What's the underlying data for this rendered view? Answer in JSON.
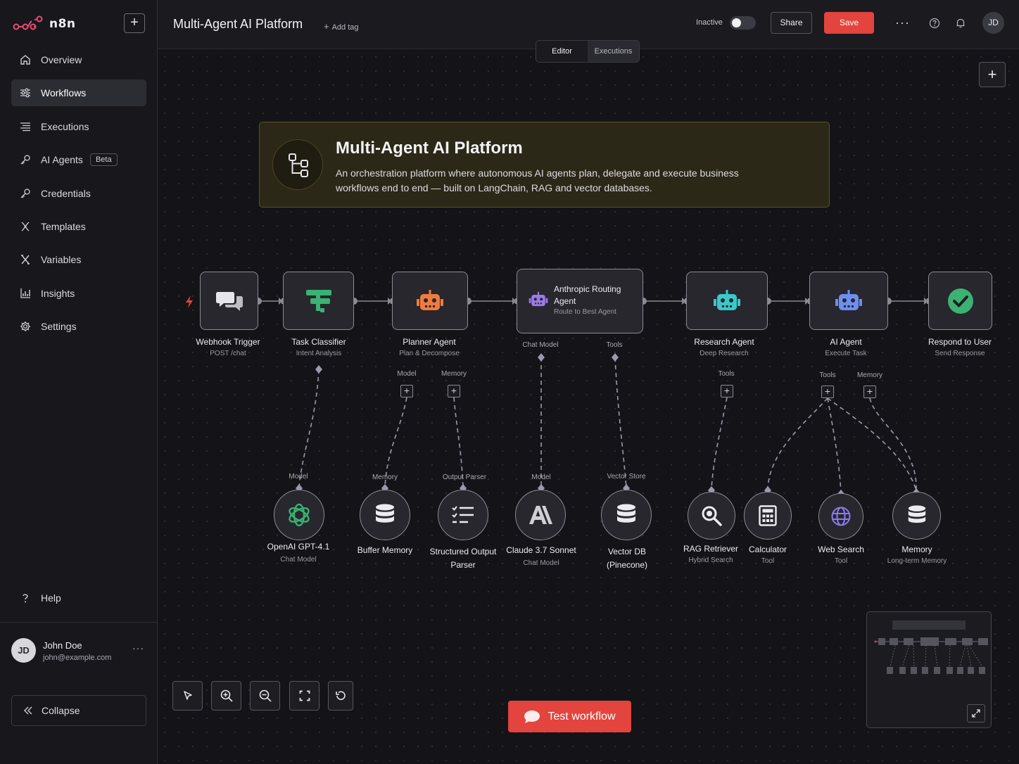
{
  "app": {
    "name": "n8n"
  },
  "sidebar": {
    "items": [
      {
        "label": "Overview",
        "icon": "home-icon"
      },
      {
        "label": "Workflows",
        "icon": "workflows-icon",
        "active": true
      },
      {
        "label": "Executions",
        "icon": "list-icon"
      },
      {
        "label": "AI Agents",
        "icon": "key-icon",
        "badge": "Beta"
      },
      {
        "label": "Credentials",
        "icon": "key-icon"
      },
      {
        "label": "Templates",
        "icon": "templates-icon"
      },
      {
        "label": "Variables",
        "icon": "variable-icon"
      },
      {
        "label": "Insights",
        "icon": "chart-icon"
      },
      {
        "label": "Settings",
        "icon": "gear-icon"
      }
    ],
    "help": "Help",
    "user": {
      "initials": "JD",
      "name": "John Doe",
      "email": "john@example.com"
    },
    "collapse": "Collapse"
  },
  "header": {
    "title": "Multi-Agent AI Platform",
    "add_tag": "Add tag",
    "status": "Inactive",
    "share": "Share",
    "save": "Save",
    "avatar": "JD"
  },
  "tabs": [
    "Editor",
    "Executions"
  ],
  "sticky": {
    "title": "Multi-Agent AI Platform",
    "description": "An orchestration platform where autonomous AI agents plan, delegate and execute business workflows end to end — built on LangChain, RAG and vector databases."
  },
  "nodes": {
    "webhook": {
      "label": "Webhook Trigger",
      "sub": "POST /chat"
    },
    "classifier": {
      "label": "Task Classifier",
      "sub": "Intent Analysis"
    },
    "planner": {
      "label": "Planner Agent",
      "sub": "Plan & Decompose",
      "port_model": "Model",
      "port_memory": "Memory"
    },
    "router": {
      "label": "Anthropic Routing Agent",
      "sub": "Route to Best Agent",
      "port_model": "Chat Model",
      "port_tools": "Tools"
    },
    "research": {
      "label": "Research Agent",
      "sub": "Deep Research",
      "port_tools": "Tools"
    },
    "agent": {
      "label": "AI Agent",
      "sub": "Execute Task",
      "port_tools": "Tools",
      "port_memory": "Memory"
    },
    "respond": {
      "label": "Respond to User",
      "sub": "Send Response"
    }
  },
  "subnodes": {
    "openai": {
      "label": "OpenAI GPT-4.1",
      "sub": "Chat Model",
      "port": "Model"
    },
    "buffer": {
      "label": "Buffer Memory",
      "port": "Memory"
    },
    "parser": {
      "label": "Structured Output Parser",
      "port": "Output Parser"
    },
    "claude": {
      "label": "Claude 3.7 Sonnet",
      "sub": "Chat Model",
      "port": "Model"
    },
    "vector": {
      "label": "Vector DB (Pinecone)",
      "port": "Vector Store"
    },
    "rag": {
      "label": "RAG Retriever",
      "sub": "Hybrid Search"
    },
    "calc": {
      "label": "Calculator",
      "sub": "Tool"
    },
    "web": {
      "label": "Web Search",
      "sub": "Tool"
    },
    "memory": {
      "label": "Memory",
      "sub": "Long-term Memory"
    }
  },
  "test_button": "Test workflow",
  "colors": {
    "accent": "#e3443d",
    "sticky_bg": "#2c2817",
    "sticky_border": "#5a5229"
  }
}
